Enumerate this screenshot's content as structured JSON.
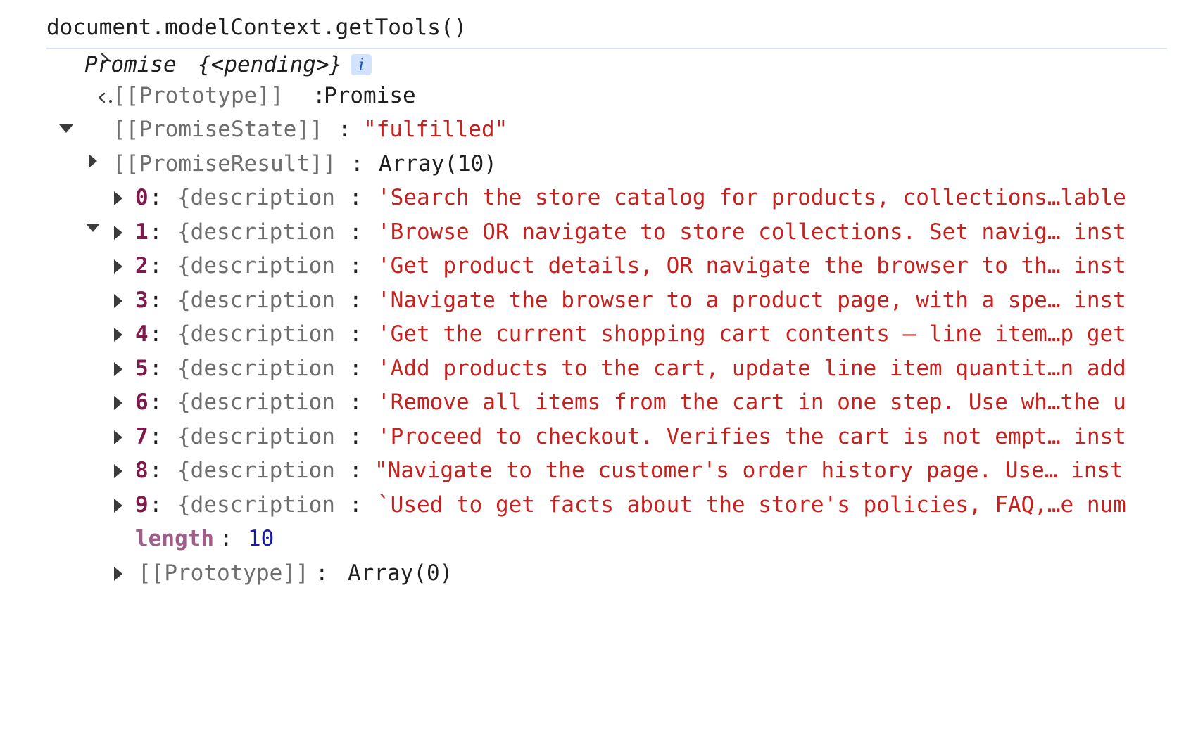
{
  "input": {
    "command": "document.modelContext.getTools()"
  },
  "output": {
    "promise_label": "Promise",
    "promise_pending": "{<pending>}",
    "info_badge": "i",
    "prototype_key": "[[Prototype]]",
    "prototype_value": "Promise",
    "state_key": "[[PromiseState]]",
    "state_value": "\"fulfilled\"",
    "result_key": "[[PromiseResult]]",
    "result_value": "Array(10)",
    "items": [
      {
        "index": "0",
        "key": "{description",
        "value": "'Search the store catalog for products, collections…lable"
      },
      {
        "index": "1",
        "key": "{description",
        "value": "'Browse OR navigate to store collections. Set navig… inst"
      },
      {
        "index": "2",
        "key": "{description",
        "value": "'Get product details, OR navigate the browser to th… inst"
      },
      {
        "index": "3",
        "key": "{description",
        "value": "'Navigate the browser to a product page, with a spe… inst"
      },
      {
        "index": "4",
        "key": "{description",
        "value": "'Get the current shopping cart contents — line item…p get"
      },
      {
        "index": "5",
        "key": "{description",
        "value": "'Add products to the cart, update line item quantit…n add"
      },
      {
        "index": "6",
        "key": "{description",
        "value": "'Remove all items from the cart in one step. Use wh…the u"
      },
      {
        "index": "7",
        "key": "{description",
        "value": "'Proceed to checkout. Verifies the cart is not empt… inst"
      },
      {
        "index": "8",
        "key": "{description",
        "value": "\"Navigate to the customer's order history page. Use… inst"
      },
      {
        "index": "9",
        "key": "{description",
        "value": "`Used to get facts about the store's policies, FAQ,…e num"
      }
    ],
    "length_key": "length",
    "length_value": "10",
    "array_proto_key": "[[Prototype]]",
    "array_proto_value": "Array(0)"
  },
  "colors": {
    "string": "#c5221f",
    "index": "#7d1a4c",
    "number": "#1a1aa6",
    "key_gray": "#6e6e6e",
    "separator": "#d6e2f3",
    "badge_bg": "#d3e3fd"
  },
  "icons": {
    "prompt": "chevron-right-icon",
    "return": "return-arrow-icon",
    "expand": "triangle-right-icon",
    "collapse": "triangle-down-icon"
  }
}
